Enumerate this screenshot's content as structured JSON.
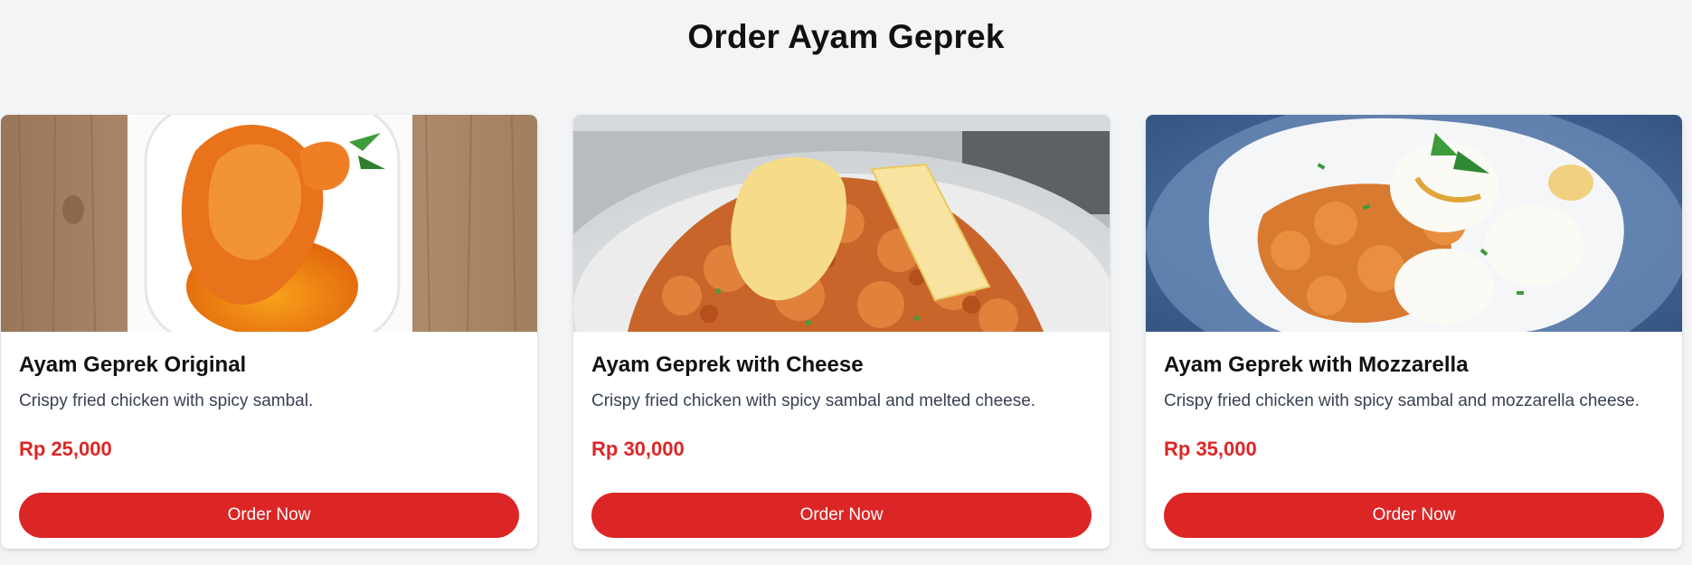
{
  "page": {
    "title": "Order Ayam Geprek"
  },
  "theme": {
    "accent": "#dc2626",
    "background": "#f3f4f6",
    "card": "#ffffff"
  },
  "products": [
    {
      "name": "Ayam Geprek Original",
      "description": "Crispy fried chicken with spicy sambal.",
      "price": "Rp 25,000",
      "button_label": "Order Now"
    },
    {
      "name": "Ayam Geprek with Cheese",
      "description": "Crispy fried chicken with spicy sambal and melted cheese.",
      "price": "Rp 30,000",
      "button_label": "Order Now"
    },
    {
      "name": "Ayam Geprek with Mozzarella",
      "description": "Crispy fried chicken with spicy sambal and mozzarella cheese.",
      "price": "Rp 35,000",
      "button_label": "Order Now"
    }
  ]
}
